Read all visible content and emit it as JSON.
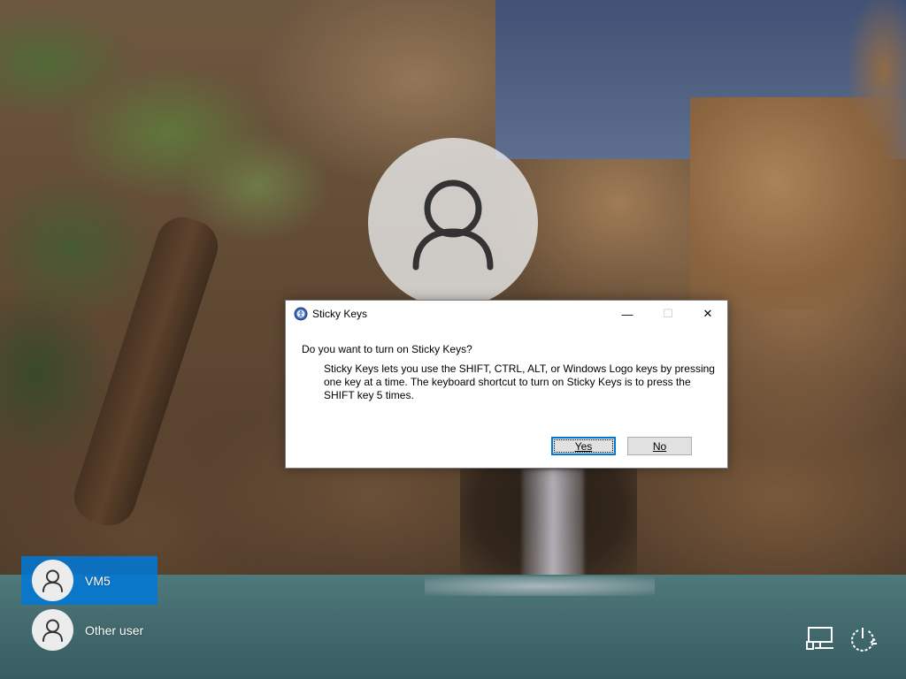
{
  "dialog": {
    "title": "Sticky Keys",
    "question": "Do you want to turn on Sticky Keys?",
    "body": "Sticky Keys lets you use the SHIFT, CTRL, ALT, or Windows Logo keys by pressing one key at a time. The keyboard shortcut to turn on Sticky Keys is to press the SHIFT key 5 times.",
    "yes_label": "Yes",
    "no_label": "No",
    "minimize_glyph": "—",
    "maximize_glyph": "☐",
    "close_glyph": "✕"
  },
  "users": [
    {
      "name": "VM5",
      "selected": true
    },
    {
      "name": "Other user",
      "selected": false
    }
  ],
  "icons": {
    "dialog": "sticky-keys-icon",
    "avatar": "user-avatar-icon",
    "network": "network-icon",
    "power": "power-icon"
  },
  "colors": {
    "accent": "#0078d7",
    "dialog_bg": "#ffffff",
    "button_bg": "#e1e1e1"
  }
}
